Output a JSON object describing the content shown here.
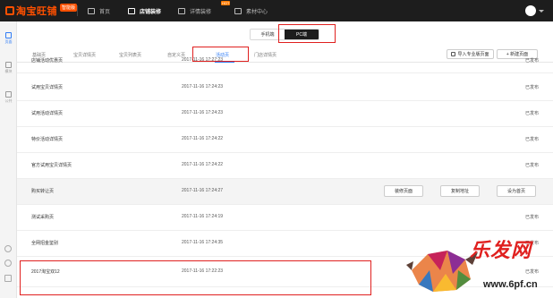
{
  "topbar": {
    "logo_text": "淘宝旺铺",
    "logo_badge": "智能版",
    "nav": [
      {
        "label": "首页"
      },
      {
        "label": "店铺装修"
      },
      {
        "label": "详情装修",
        "badge": "HOT"
      },
      {
        "label": "素材中心"
      }
    ]
  },
  "rail": {
    "items": [
      {
        "label": "页面"
      },
      {
        "label": "模块"
      },
      {
        "label": "公共"
      }
    ]
  },
  "device_toggle": {
    "mobile_label": "手机端",
    "pc_label": "PC端",
    "active": "pc"
  },
  "tabs": [
    {
      "label": "基础页"
    },
    {
      "label": "宝贝详情页"
    },
    {
      "label": "宝贝列表页"
    },
    {
      "label": "自定义页"
    },
    {
      "label": "活动页",
      "active": true
    },
    {
      "label": "门店详情页"
    }
  ],
  "actions": {
    "import_label": "导入专业版页面",
    "new_page_label": "+ 新建页面"
  },
  "pages": [
    {
      "name": "店铺活动优惠页",
      "time": "2017-11-16 17:27:23",
      "status": "已发布"
    },
    {
      "name": "试用宝贝详情页",
      "time": "2017-11-16 17:24:23",
      "status": "已发布"
    },
    {
      "name": "试用活动详情页",
      "time": "2017-11-16 17:24:23",
      "status": "已发布"
    },
    {
      "name": "特价活动详情页",
      "time": "2017-11-16 17:24:22",
      "status": "已发布"
    },
    {
      "name": "官方试用宝贝详情页",
      "time": "2017-11-16 17:24:22",
      "status": "已发布"
    },
    {
      "name": "购买转让页",
      "time": "2017-11-16 17:24:27",
      "status": "",
      "hover": true,
      "buttons": [
        "装修页面",
        "复制地址",
        "设为首页"
      ]
    },
    {
      "name": "测试采购页",
      "time": "2017-11-16 17:24:19",
      "status": "已发布"
    },
    {
      "name": "全网招金鉴别",
      "time": "2017-11-16 17:24:35",
      "status": "已发布"
    },
    {
      "name": "2017淘宝双12",
      "time": "2017-11-16 17:22:23",
      "status": "已发布"
    }
  ],
  "watermark": {
    "text": "乐发网",
    "url": "www.6pf.cn"
  },
  "colors": {
    "topbar_bg": "#1d1d1d",
    "brand": "#ff5000",
    "accent": "#2f7cf6",
    "highlight": "#e0201f"
  }
}
